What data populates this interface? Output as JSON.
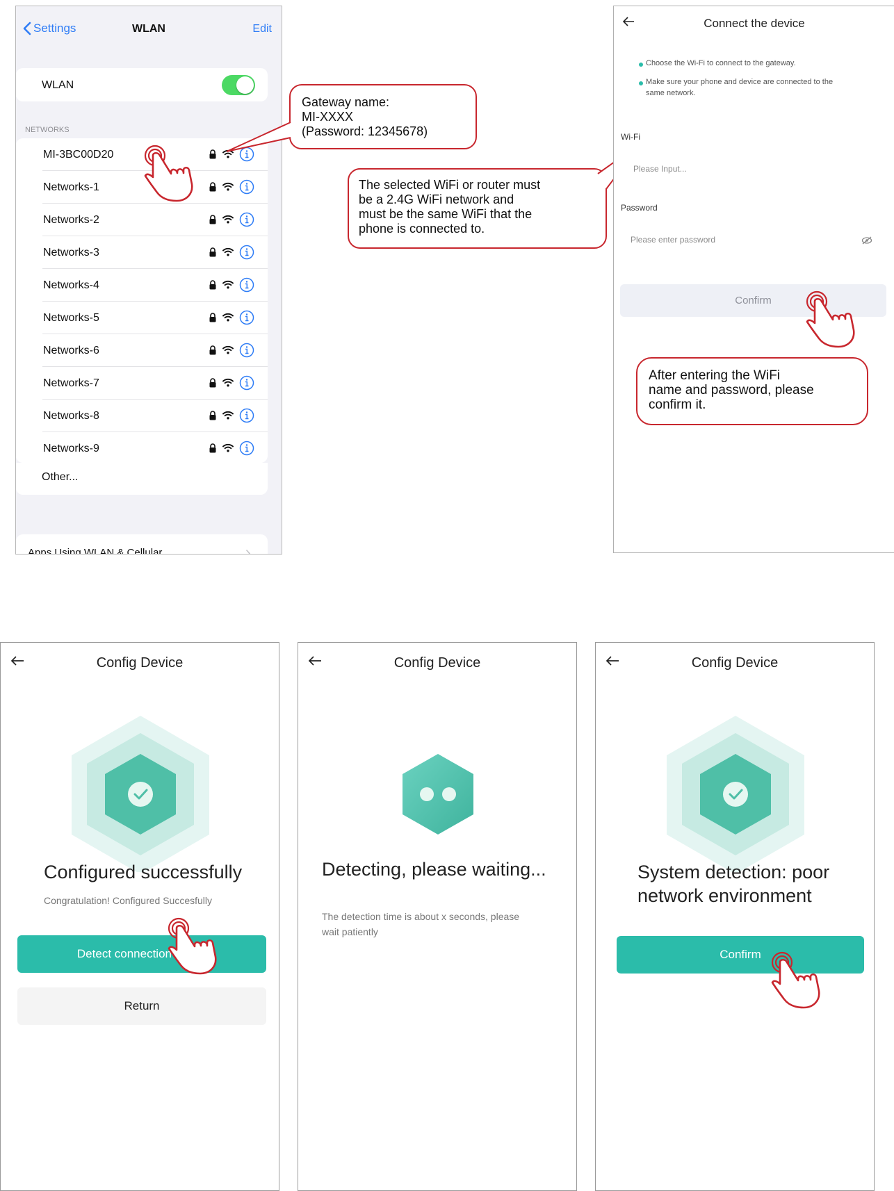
{
  "wlan_screen": {
    "back_label": "Settings",
    "title": "WLAN",
    "edit_label": "Edit",
    "wlan_toggle_label": "WLAN",
    "wlan_toggle_on": true,
    "section_header": "NETWORKS",
    "networks": [
      "MI-3BC00D20",
      "Networks-1",
      "Networks-2",
      "Networks-3",
      "Networks-4",
      "Networks-5",
      "Networks-6",
      "Networks-7",
      "Networks-8",
      "Networks-9"
    ],
    "other_label": "Other...",
    "apps_label": "Apps Using WLAN & Cellular",
    "accent_color": "#2f7df6",
    "toggle_color": "#4cd964"
  },
  "callouts": {
    "gateway_line1": "Gateway name:",
    "gateway_line2": "MI-XXXX",
    "gateway_line3": "(Password: 12345678)",
    "wifi_note_line1": "The selected WiFi or router must",
    "wifi_note_line2": "be a 2.4G WiFi network and",
    "wifi_note_line3": "must be the same WiFi that the",
    "wifi_note_line4": "phone is connected to.",
    "confirm_note_line1": "After entering the WiFi",
    "confirm_note_line2": "name and password, please",
    "confirm_note_line3": "confirm it.",
    "border_color": "#c8272e"
  },
  "connect_screen": {
    "title": "Connect the device",
    "tip1": "Choose the Wi-Fi to connect to the gateway.",
    "tip2_line1": "Make sure your phone and device are connected to the",
    "tip2_line2": "same network.",
    "wifi_label": "Wi-Fi",
    "wifi_placeholder": "Please Input...",
    "password_label": "Password",
    "password_placeholder": "Please enter password",
    "confirm_label": "Confirm"
  },
  "config_success": {
    "title": "Config Device",
    "heading": "Configured successfully",
    "subtext": "Congratulation! Configured Succesfully",
    "detect_button": "Detect connection status",
    "return_button": "Return"
  },
  "config_detecting": {
    "title": "Config Device",
    "heading": "Detecting, please waiting...",
    "subtext_line1": "The detection time is about x seconds, please",
    "subtext_line2": "wait patiently"
  },
  "config_poor": {
    "title": "Config Device",
    "heading_line1": "System detection: poor",
    "heading_line2": "network environment",
    "confirm_button": "Confirm"
  },
  "colors": {
    "teal": "#2bbcaa"
  }
}
